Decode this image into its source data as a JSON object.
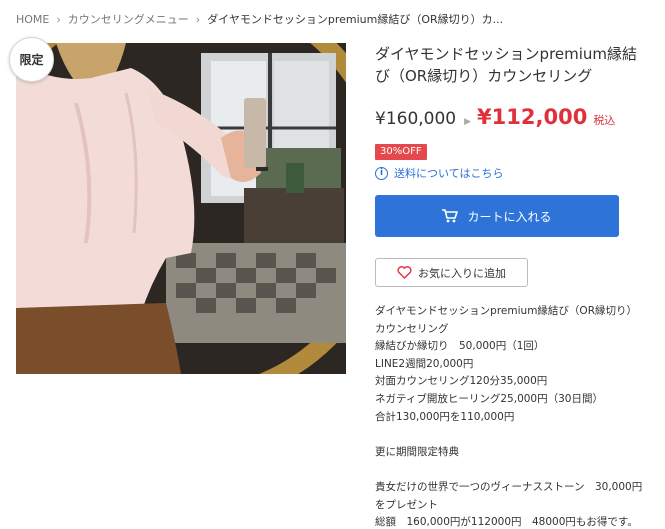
{
  "breadcrumb": {
    "home": "HOME",
    "category": "カウンセリングメニュー",
    "current": "ダイヤモンドセッションpremium縁結び（OR縁切り）カ..."
  },
  "badge": {
    "label": "限定"
  },
  "product": {
    "title": "ダイヤモンドセッションpremium縁結び（OR縁切り）カウンセリング",
    "price_original": "¥160,000",
    "price_sale": "¥112,000",
    "tax_label": "税込",
    "discount_label": "30%OFF",
    "shipping_link": "送料についてはこちら",
    "cart_button": "カートに入れる",
    "favorite_button": "お気に入りに追加"
  },
  "description": [
    "ダイヤモンドセッションpremium縁結び（OR縁切り）カウンセリング",
    "縁結びか縁切り　50,000円（1回）",
    "LINE2週間20,000円",
    "対面カウンセリング120分35,000円",
    "ネガティブ開放ヒーリング25,000円（30日間）",
    "合計130,000円を110,000円",
    "",
    "更に期間限定特典",
    "",
    "貴女だけの世界で一つのヴィーナスストーン　30,000円をプレゼント",
    "総額　160,000円が112000円　48000円もお得です。"
  ],
  "colors": {
    "sale_red": "#e0313b",
    "discount_badge": "#e5484d",
    "link_blue": "#2b6fd6",
    "cart_button_blue": "#2e74d8"
  },
  "icons": {
    "breadcrumb_separator": "chevron-right-icon",
    "price_arrow": "triangle-right-icon",
    "shipping": "info-circle-icon",
    "cart": "cart-icon",
    "favorite": "heart-outline-icon"
  }
}
